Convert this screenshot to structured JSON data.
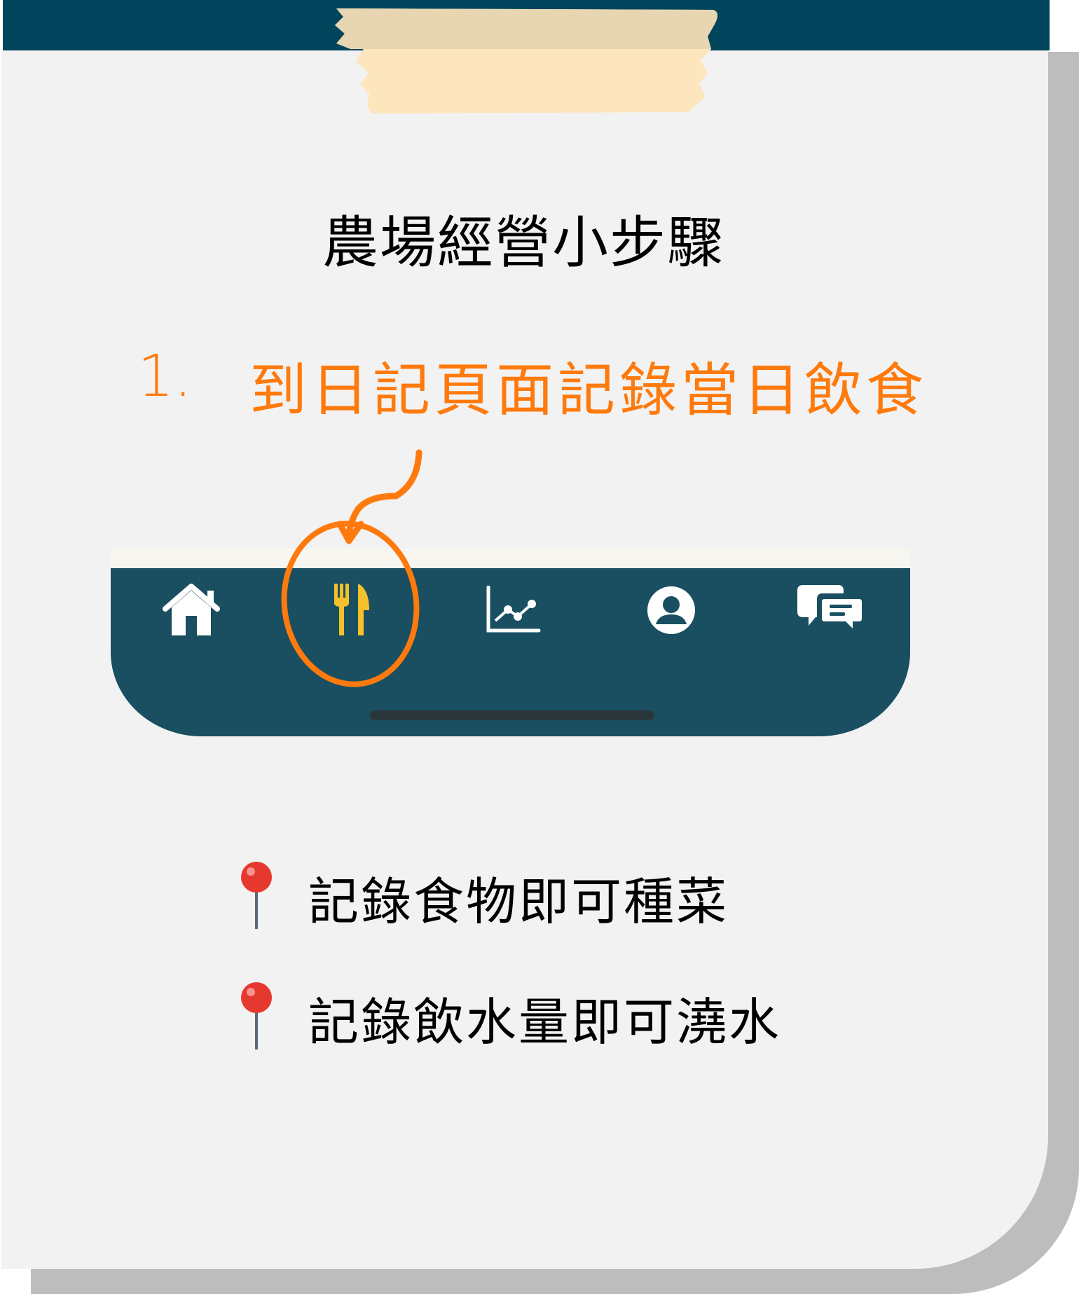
{
  "title": "農場經營小步驟",
  "step": {
    "number": "1.",
    "text": "到日記頁面記錄當日飲食"
  },
  "nav": {
    "items": [
      {
        "icon": "home-icon"
      },
      {
        "icon": "fork-knife-icon",
        "active": true,
        "color": "#f5c02b"
      },
      {
        "icon": "chart-icon"
      },
      {
        "icon": "profile-icon"
      },
      {
        "icon": "chat-icon"
      }
    ]
  },
  "bullets": [
    {
      "icon": "pushpin-icon",
      "text": "記錄食物即可種菜"
    },
    {
      "icon": "pushpin-icon",
      "text": "記錄飲水量即可澆水"
    }
  ],
  "colors": {
    "accent": "#ff7a0c",
    "nav_bg": "#194f60",
    "header": "#00455c"
  }
}
